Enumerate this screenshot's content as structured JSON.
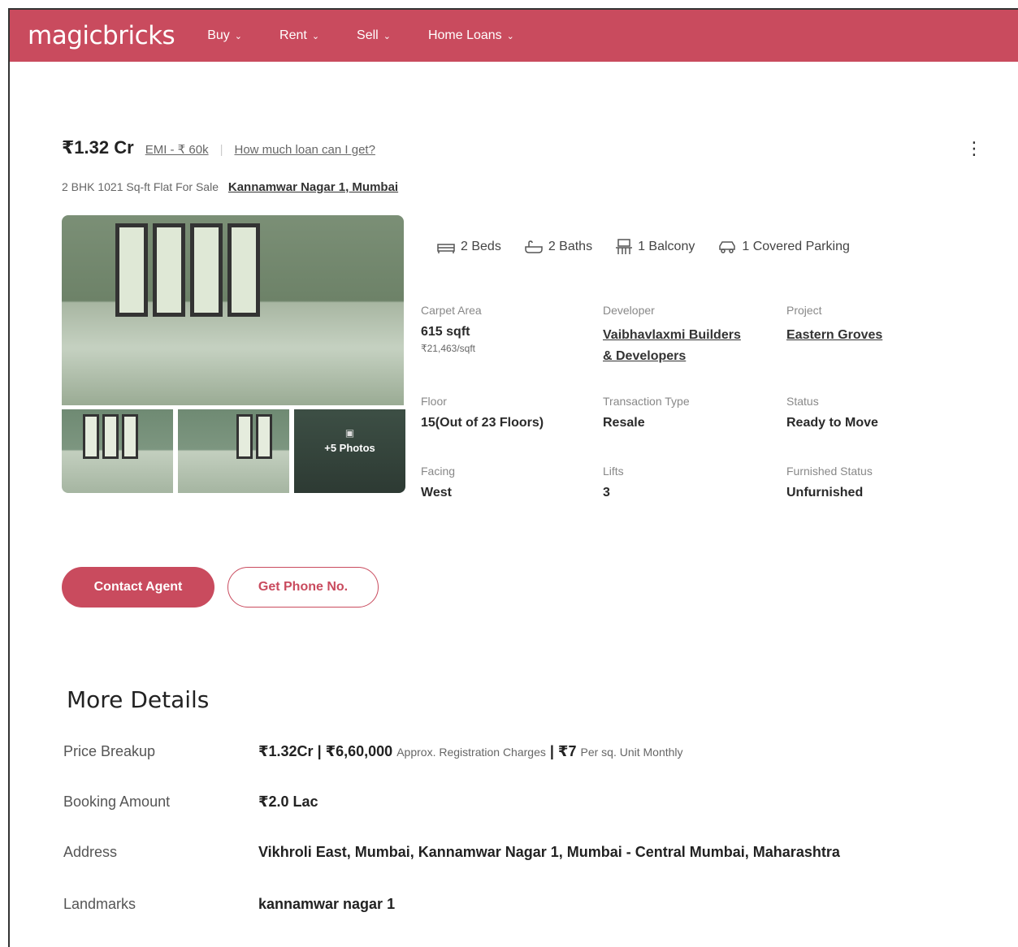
{
  "header": {
    "logo": "magicbricks",
    "nav": [
      {
        "label": "Buy"
      },
      {
        "label": "Rent"
      },
      {
        "label": "Sell"
      },
      {
        "label": "Home Loans"
      }
    ]
  },
  "listing": {
    "price": "₹1.32 Cr",
    "emi": "EMI - ₹ 60k",
    "separator": "|",
    "loan_link": "How much loan can I get?",
    "subtitle": "2 BHK 1021 Sq-ft Flat For Sale",
    "locality": "Kannamwar Nagar 1, Mumbai",
    "more_photos": "+5 Photos",
    "amenities": {
      "beds": "2 Beds",
      "baths": "2 Baths",
      "balcony": "1 Balcony",
      "parking": "1 Covered Parking"
    },
    "specs": {
      "carpet_area_label": "Carpet Area",
      "carpet_area_value": "615 sqft",
      "carpet_area_rate": "₹21,463/sqft",
      "developer_label": "Developer",
      "developer_line1": "Vaibhavlaxmi Builders",
      "developer_line2": "& Developers",
      "project_label": "Project",
      "project_value": "Eastern Groves",
      "floor_label": "Floor",
      "floor_value": "15(Out of 23 Floors)",
      "transaction_label": "Transaction Type",
      "transaction_value": "Resale",
      "status_label": "Status",
      "status_value": "Ready to Move",
      "facing_label": "Facing",
      "facing_value": "West",
      "lifts_label": "Lifts",
      "lifts_value": "3",
      "furnished_label": "Furnished Status",
      "furnished_value": "Unfurnished"
    },
    "buttons": {
      "contact": "Contact Agent",
      "phone": "Get Phone No."
    }
  },
  "more_details": {
    "title": "More Details",
    "price_breakup_label": "Price Breakup",
    "price_breakup_value": "₹1.32Cr | ₹6,60,000",
    "price_breakup_note": "Approx. Registration Charges",
    "price_breakup_maint": "| ₹7",
    "price_breakup_unit": "Per sq. Unit Monthly",
    "booking_label": "Booking Amount",
    "booking_value": "₹2.0 Lac",
    "address_label": "Address",
    "address_value": "Vikhroli East, Mumbai, Kannamwar Nagar 1, Mumbai - Central Mumbai, Maharashtra",
    "landmarks_label": "Landmarks",
    "landmarks_value": "kannamwar nagar 1"
  },
  "colors": {
    "brand": "#c94b5e"
  }
}
